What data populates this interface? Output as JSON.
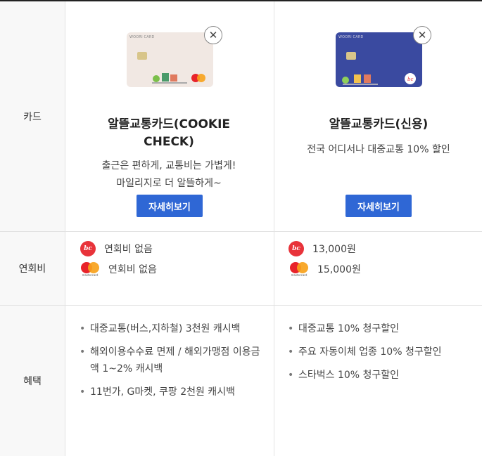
{
  "labels": {
    "card": "카드",
    "annual_fee": "연회비",
    "benefits": "혜택"
  },
  "cards": [
    {
      "brand_text": "WOORI CARD",
      "title": "알뜰교통카드(COOKIE CHECK)",
      "desc_lines": [
        "출근은 편하게, 교통비는 가볍게!",
        "마일리지로 더 알뜰하게~"
      ],
      "detail_label": "자세히보기",
      "close_glyph": "✕",
      "fees": [
        {
          "network": "bc",
          "text": "연회비 없음"
        },
        {
          "network": "mastercard",
          "text": "연회비 없음"
        }
      ],
      "benefits": [
        "대중교통(버스,지하철) 3천원 캐시백",
        "해외이용수수료 면제 / 해외가맹점 이용금액 1~2% 캐시백",
        "11번가, G마켓, 쿠팡 2천원 캐시백"
      ]
    },
    {
      "brand_text": "WOORI CARD",
      "title": "알뜰교통카드(신용)",
      "desc_lines": [
        "전국 어디서나 대중교통 10% 할인"
      ],
      "detail_label": "자세히보기",
      "close_glyph": "✕",
      "fees": [
        {
          "network": "bc",
          "text": "13,000원"
        },
        {
          "network": "mastercard",
          "text": "15,000원"
        }
      ],
      "benefits": [
        "대중교통 10% 청구할인",
        "주요 자동이체 업종 10% 청구할인",
        "스타벅스 10% 청구할인"
      ]
    }
  ],
  "logos": {
    "bc": "bc",
    "mastercard": "mastercard"
  },
  "colors": {
    "button": "#2f67d5",
    "bc_red": "#e8333a",
    "mc_red": "#e8232a",
    "mc_orange": "#f7a21b"
  }
}
